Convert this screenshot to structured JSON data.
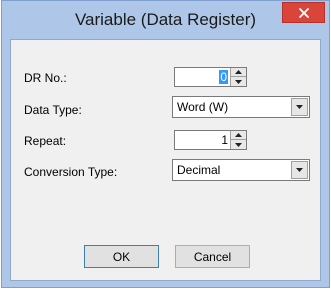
{
  "window": {
    "title": "Variable (Data Register)",
    "close_glyph": "✕"
  },
  "form": {
    "dr_no": {
      "label": "DR No.:",
      "value": "0"
    },
    "data_type": {
      "label": "Data Type:",
      "value": "Word (W)"
    },
    "repeat": {
      "label": "Repeat:",
      "value": "1"
    },
    "conversion_type": {
      "label": "Conversion Type:",
      "value": "Decimal"
    }
  },
  "buttons": {
    "ok": "OK",
    "cancel": "Cancel"
  },
  "icons": {
    "close": "close-icon",
    "spin_up": "arrow-up-icon",
    "spin_down": "arrow-down-icon",
    "dropdown": "chevron-down-icon"
  },
  "colors": {
    "titlebar": "#aec7e9",
    "close_button": "#d9453b",
    "client_background": "#f0f0f0",
    "selection": "#3399ff"
  }
}
